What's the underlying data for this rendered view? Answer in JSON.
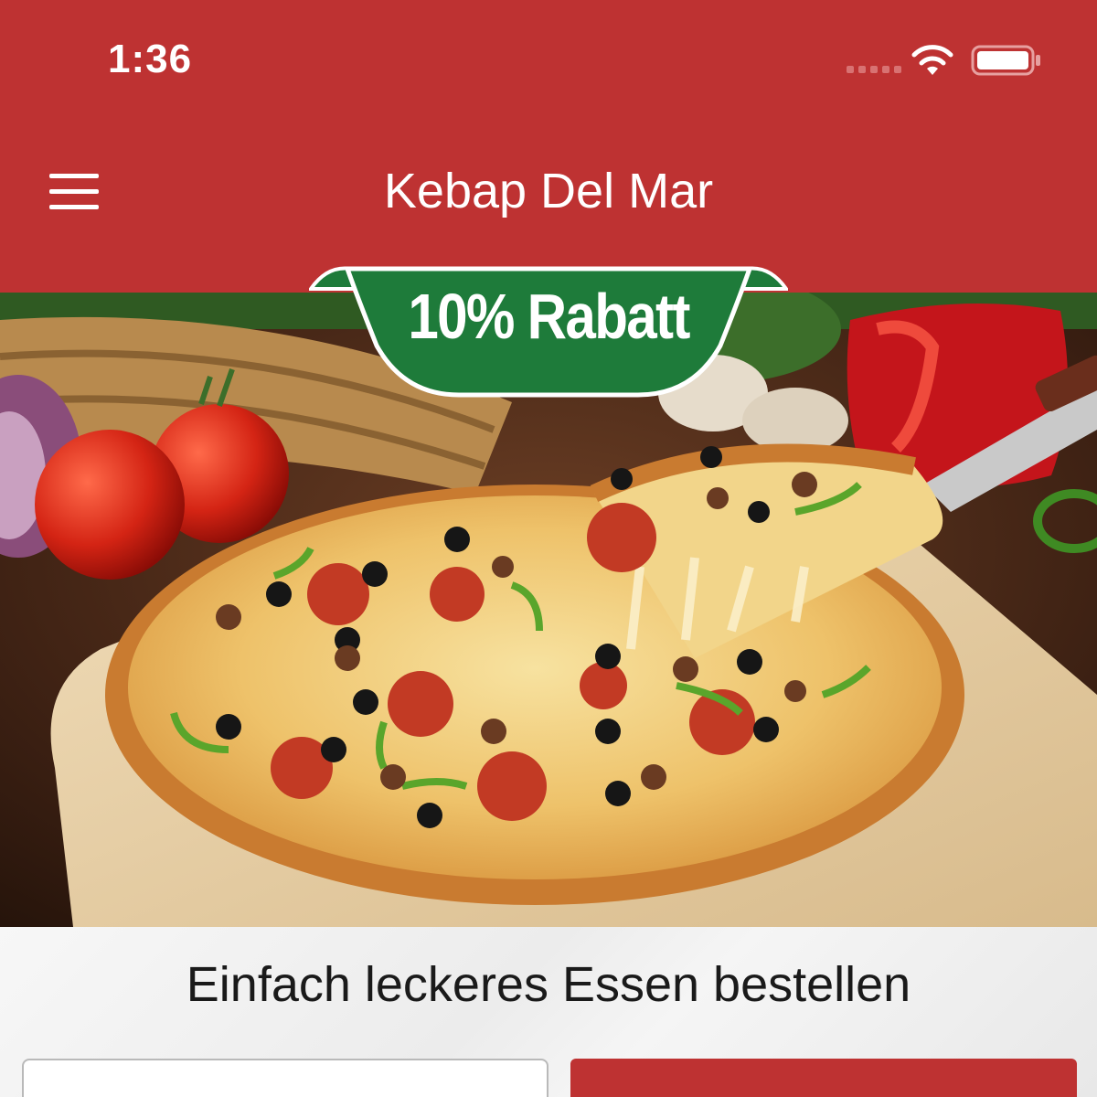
{
  "status_bar": {
    "time": "1:36"
  },
  "header": {
    "title": "Kebap Del Mar"
  },
  "promo": {
    "label": "10% Rabatt"
  },
  "main": {
    "tagline": "Einfach leckeres Essen bestellen"
  },
  "colors": {
    "brand_red": "#be3232",
    "badge_green": "#1e7b3a"
  },
  "icons": {
    "menu": "hamburger-menu-icon",
    "wifi": "wifi-icon",
    "battery": "battery-icon"
  }
}
